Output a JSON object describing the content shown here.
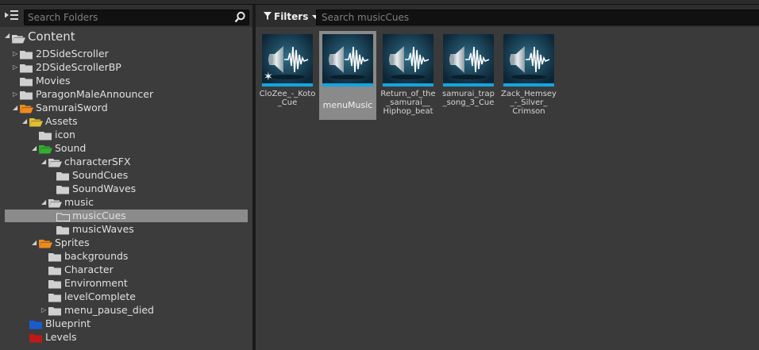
{
  "colors": {
    "selection_tree": "#8b8b8b",
    "tile_bar": "#12a6e0",
    "folder_grey": "#d0d0d0",
    "folder_orange": "#f08a1c",
    "folder_yellow": "#e0c030",
    "folder_green": "#30b030",
    "folder_blue": "#1a5bd0",
    "folder_red": "#c01818"
  },
  "left_panel": {
    "search_placeholder": "Search Folders",
    "tree": [
      {
        "label": "Content",
        "color": "grey",
        "expanded": true,
        "arrow": "expanded",
        "indent": 0,
        "big": true
      },
      {
        "label": "2DSideScroller",
        "color": "grey",
        "arrow": "collapsed",
        "indent": 1
      },
      {
        "label": "2DSideScrollerBP",
        "color": "grey",
        "arrow": "collapsed",
        "indent": 1
      },
      {
        "label": "Movies",
        "color": "grey",
        "arrow": "none",
        "indent": 1
      },
      {
        "label": "ParagonMaleAnnouncer",
        "color": "grey",
        "arrow": "collapsed",
        "indent": 1
      },
      {
        "label": "SamuraiSword",
        "color": "orange",
        "arrow": "expanded",
        "indent": 1,
        "open": true
      },
      {
        "label": "Assets",
        "color": "yellow",
        "arrow": "expanded",
        "indent": 2,
        "open": true
      },
      {
        "label": "icon",
        "color": "grey",
        "arrow": "none",
        "indent": 3
      },
      {
        "label": "Sound",
        "color": "green",
        "arrow": "expanded",
        "indent": 3,
        "open": true
      },
      {
        "label": "characterSFX",
        "color": "grey",
        "arrow": "expanded",
        "indent": 4,
        "open": true
      },
      {
        "label": "SoundCues",
        "color": "grey",
        "arrow": "none",
        "indent": 5
      },
      {
        "label": "SoundWaves",
        "color": "grey",
        "arrow": "none",
        "indent": 5
      },
      {
        "label": "music",
        "color": "grey",
        "arrow": "expanded",
        "indent": 4,
        "open": true
      },
      {
        "label": "musicCues",
        "color": "grey",
        "arrow": "none",
        "indent": 5,
        "selected": true,
        "outline": true
      },
      {
        "label": "musicWaves",
        "color": "grey",
        "arrow": "none",
        "indent": 5
      },
      {
        "label": "Sprites",
        "color": "orange",
        "arrow": "expanded",
        "indent": 3,
        "open": true
      },
      {
        "label": "backgrounds",
        "color": "grey",
        "arrow": "none",
        "indent": 4
      },
      {
        "label": "Character",
        "color": "grey",
        "arrow": "none",
        "indent": 4
      },
      {
        "label": "Environment",
        "color": "grey",
        "arrow": "none",
        "indent": 4
      },
      {
        "label": "levelComplete",
        "color": "grey",
        "arrow": "none",
        "indent": 4
      },
      {
        "label": "menu_pause_died",
        "color": "grey",
        "arrow": "collapsed",
        "indent": 4
      },
      {
        "label": "Blueprint",
        "color": "blue",
        "arrow": "none",
        "indent": 2
      },
      {
        "label": "Levels",
        "color": "red",
        "arrow": "none",
        "indent": 2
      }
    ]
  },
  "right_panel": {
    "filters_label": "Filters",
    "search_placeholder": "Search musicCues",
    "assets": [
      {
        "name": "CloZee_-_Koto_Cue",
        "name_display": "CloZee_-_Koto\n_Cue",
        "icon": "sound-cue-icon",
        "selected": false,
        "new_badge": true
      },
      {
        "name": "menuMusic",
        "name_display": "menuMusic",
        "icon": "sound-cue-icon",
        "selected": true,
        "new_badge": false
      },
      {
        "name": "Return_of_the_samurai__Hiphop_beat",
        "name_display": "Return_of_the\n_samurai__\nHiphop_beat",
        "icon": "sound-cue-icon",
        "selected": false,
        "new_badge": false
      },
      {
        "name": "samurai_trap_song_3_Cue",
        "name_display": "samurai_trap\n_song_3_Cue",
        "icon": "sound-cue-icon",
        "selected": false,
        "new_badge": false
      },
      {
        "name": "Zack_Hemsey_-_Silver_Crimson",
        "name_display": "Zack_Hemsey\n_-_Silver_\nCrimson",
        "icon": "sound-cue-icon",
        "selected": false,
        "new_badge": false
      }
    ]
  }
}
